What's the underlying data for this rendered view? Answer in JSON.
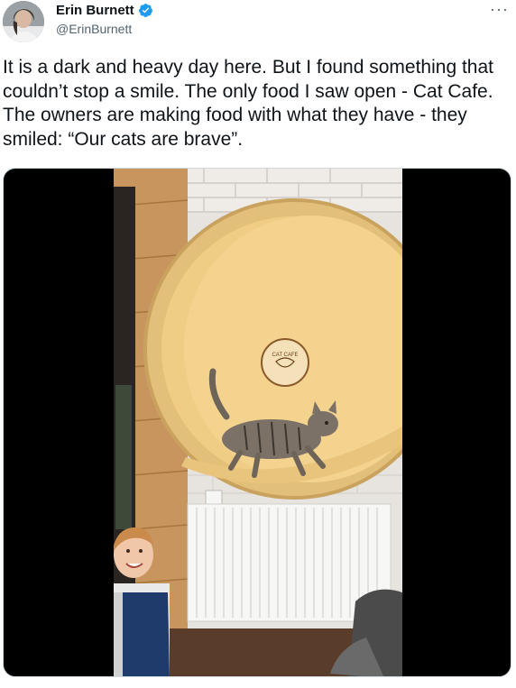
{
  "author": {
    "name": "Erin Burnett",
    "handle": "@ErinBurnett",
    "verified": true,
    "avatar_icon": "user-avatar-photo",
    "verified_icon": "verified-badge-icon"
  },
  "menu": {
    "label": "···",
    "icon": "more-options-icon"
  },
  "tweet": {
    "text": "It is a dark and heavy day here. But I found something that couldn’t stop a smile. The only food I saw open - Cat Cafe. The owners are making food with what they have - they smiled: “Our cats are brave”."
  },
  "media": {
    "type": "video",
    "description_icon": "cat-wheel-video",
    "sign_text": "CAT CAFE"
  },
  "colors": {
    "text": "#0f1419",
    "secondary": "#536471",
    "verified": "#1d9bf0",
    "media_bg": "#000000"
  }
}
